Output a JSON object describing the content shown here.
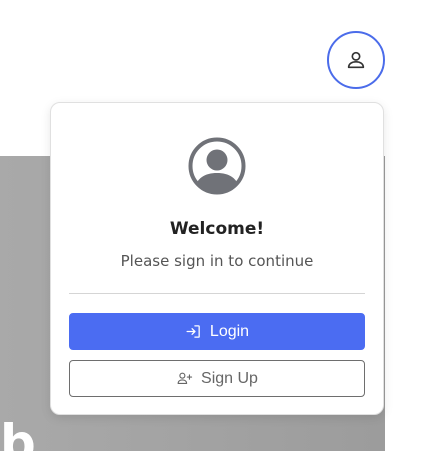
{
  "header": {
    "account_button_icon": "user-outline-icon"
  },
  "background": {
    "hero_text": "b"
  },
  "auth_popover": {
    "avatar_icon": "user-circle-icon",
    "title": "Welcome!",
    "subtitle": "Please sign in to continue",
    "login_button": {
      "label": "Login",
      "icon": "login-icon"
    },
    "signup_button": {
      "label": "Sign Up",
      "icon": "user-plus-icon"
    }
  },
  "colors": {
    "accent": "#4b6cf2",
    "avatar": "#707278",
    "backdrop": "#a3a3a3"
  }
}
